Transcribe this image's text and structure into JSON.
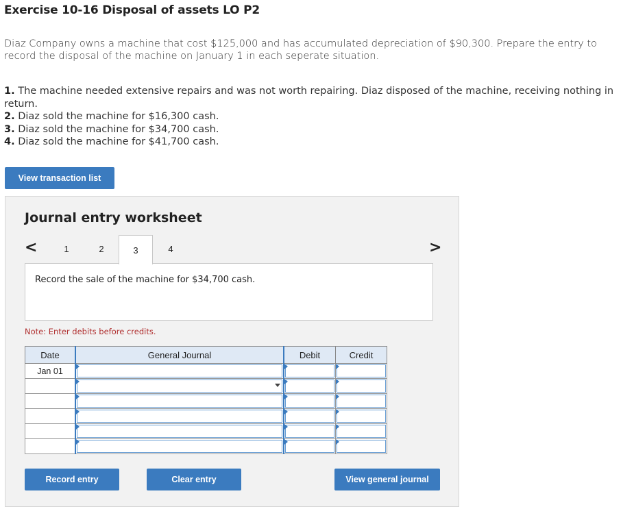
{
  "header": {
    "title": "Exercise 10-16 Disposal of assets LO P2"
  },
  "intro": "Diaz Company owns a machine that cost $125,000 and has accumulated depreciation of $90,300. Prepare the entry to record the disposal of the machine on January 1 in each seperate situation.",
  "situations": [
    {
      "num": "1.",
      "text": "The machine needed extensive repairs and was not worth repairing. Diaz disposed of the machine, receiving nothing in return."
    },
    {
      "num": "2.",
      "text": "Diaz sold the machine for $16,300 cash."
    },
    {
      "num": "3.",
      "text": "Diaz sold the machine for $34,700 cash."
    },
    {
      "num": "4.",
      "text": "Diaz sold the machine for $41,700 cash."
    }
  ],
  "buttons": {
    "view_transaction_list": "View transaction list",
    "record_entry": "Record entry",
    "clear_entry": "Clear entry",
    "view_general_journal": "View general journal"
  },
  "worksheet": {
    "title": "Journal entry worksheet",
    "prev_arrow": "<",
    "next_arrow": ">",
    "tabs": [
      "1",
      "2",
      "3",
      "4"
    ],
    "active_tab": "3",
    "description": "Record the sale of the machine for $34,700 cash.",
    "note": "Note: Enter debits before credits."
  },
  "journal": {
    "headers": {
      "date": "Date",
      "general_journal": "General Journal",
      "debit": "Debit",
      "credit": "Credit"
    },
    "rows": [
      {
        "date": "Jan 01",
        "account": "",
        "debit": "",
        "credit": ""
      },
      {
        "date": "",
        "account": "",
        "debit": "",
        "credit": ""
      },
      {
        "date": "",
        "account": "",
        "debit": "",
        "credit": ""
      },
      {
        "date": "",
        "account": "",
        "debit": "",
        "credit": ""
      },
      {
        "date": "",
        "account": "",
        "debit": "",
        "credit": ""
      },
      {
        "date": "",
        "account": "",
        "debit": "",
        "credit": ""
      }
    ]
  },
  "colors": {
    "accent": "#3b7bbf",
    "note": "#b03030",
    "header_fill": "#dfe9f5"
  }
}
